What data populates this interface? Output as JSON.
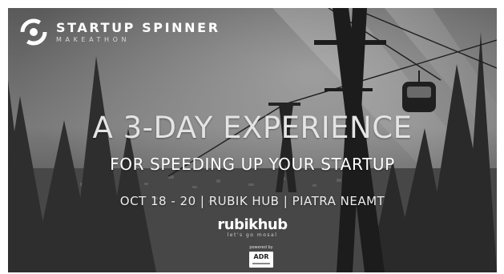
{
  "brand": {
    "name": "STARTUP SPINNER",
    "subtitle": "MAKEATHON"
  },
  "hero": {
    "headline": "A 3-DAY EXPERIENCE",
    "subheadline": "FOR SPEEDING UP YOUR STARTUP",
    "details": "OCT 18 - 20 | RUBIK HUB | PIATRA NEAMT"
  },
  "host": {
    "name": "rubikhub",
    "tagline": "let's go mosal"
  },
  "sponsor": {
    "caption": "powered by",
    "name": "ADR"
  },
  "icons": {
    "brand_logo": "spinner-logo-icon",
    "sponsor_logo": "adr-logo-icon"
  },
  "colors": {
    "overlay": "#3a3a3a",
    "text": "#ffffff"
  }
}
